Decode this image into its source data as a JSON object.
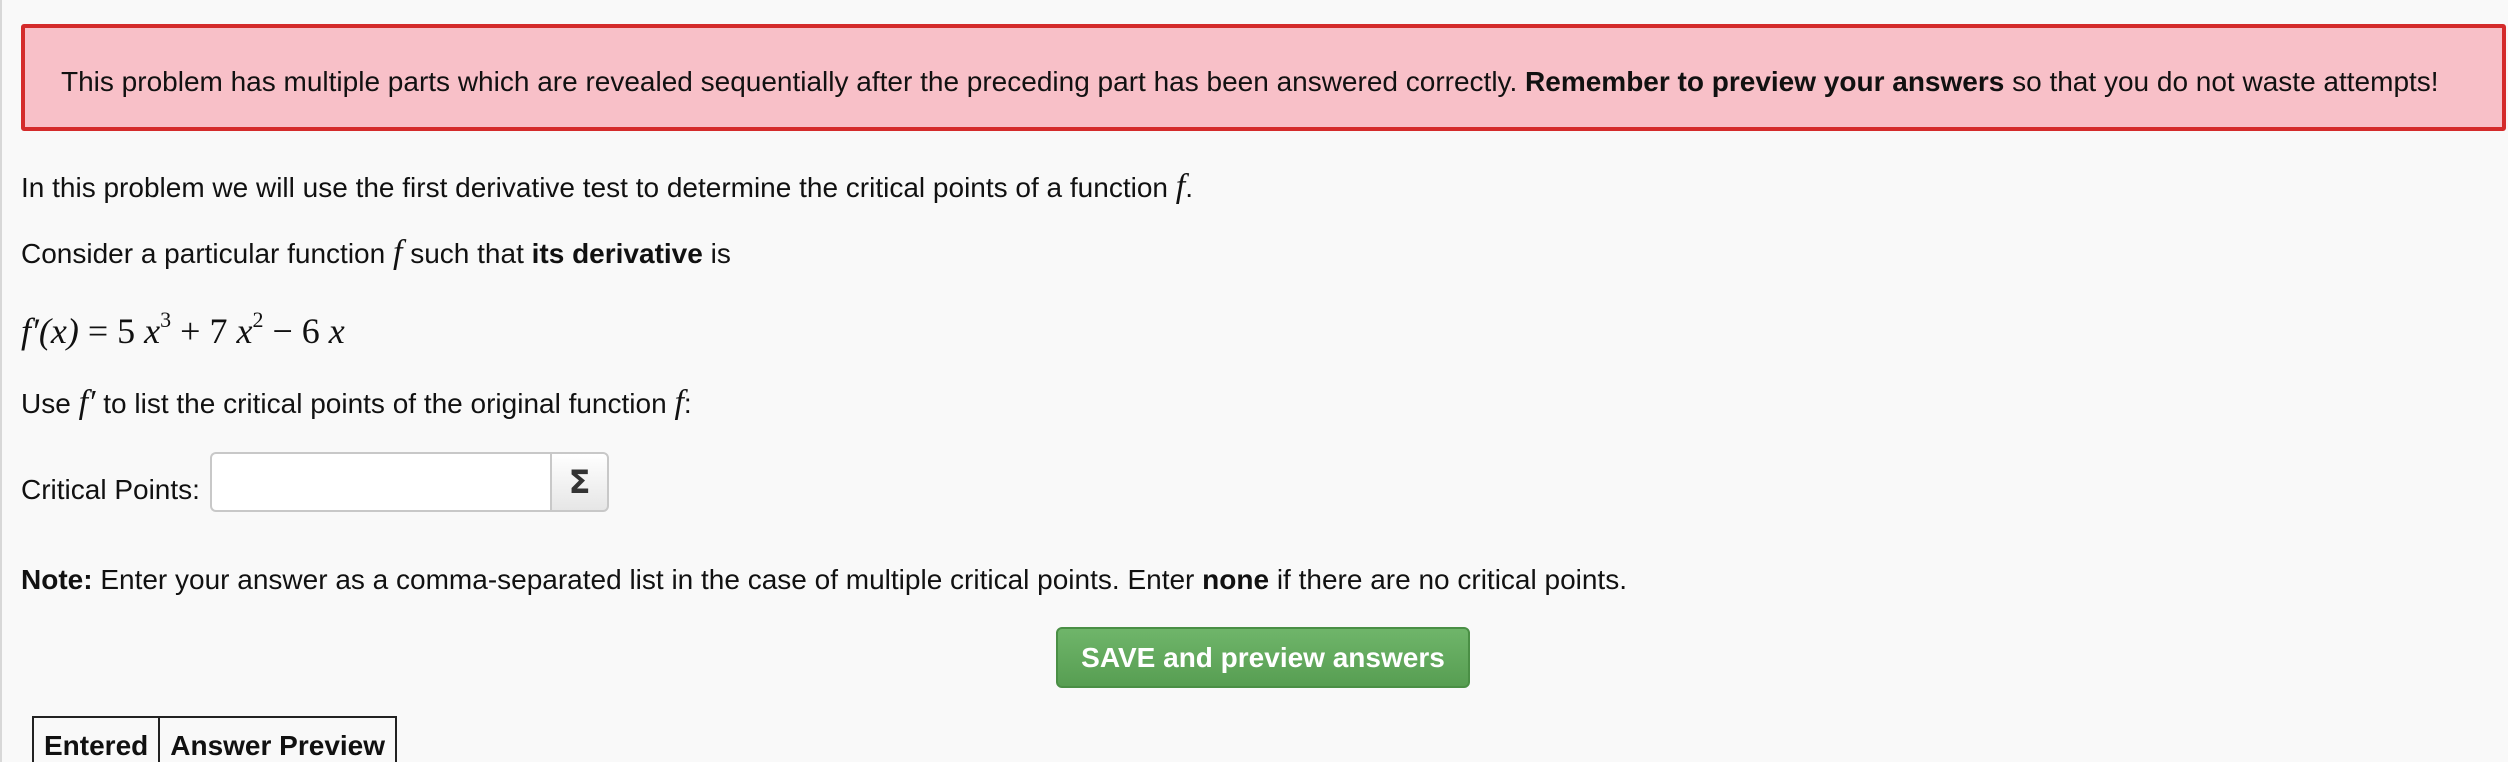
{
  "alert": {
    "text_before": "This problem has multiple parts which are revealed sequentially after the preceding part has been answered correctly. ",
    "text_bold": "Remember to preview your answers",
    "text_after": " so that you do not waste attempts!"
  },
  "intro": {
    "text": "In this problem we will use the first derivative test to determine the critical points of a function ",
    "fn": "f",
    "end": "."
  },
  "consider": {
    "before": "Consider a particular function ",
    "fn": "f",
    "middle": " such that ",
    "bold": "its derivative",
    "after": " is"
  },
  "formula": {
    "lhs": "f′(x)",
    "equals": " = ",
    "term1_coef": "5 ",
    "term1_var": "x",
    "term1_exp": "3",
    "op1": " + ",
    "term2_coef": "7 ",
    "term2_var": "x",
    "term2_exp": "2",
    "op2": " − ",
    "term3_coef": "6 ",
    "term3_var": "x"
  },
  "use_line": {
    "before": "Use ",
    "fprime": "f′",
    "middle": "  to list the critical points of the original function ",
    "fn": "f",
    "end": ":"
  },
  "answer": {
    "label": "Critical Points:",
    "value": "",
    "placeholder": "",
    "equation_editor_symbol": "Σ"
  },
  "note": {
    "bold": "Note:",
    "text": " Enter your answer as a comma-separated list in the case of multiple critical points. Enter ",
    "bold2": "none",
    "text2": " if there are no critical points."
  },
  "save_button_label": "SAVE and preview answers",
  "results_table": {
    "headers": [
      "Entered",
      "Answer Preview"
    ]
  },
  "colors": {
    "alert_bg": "#f8c0c8",
    "alert_border": "#d42b2b",
    "save_button": "#5fa85a"
  }
}
